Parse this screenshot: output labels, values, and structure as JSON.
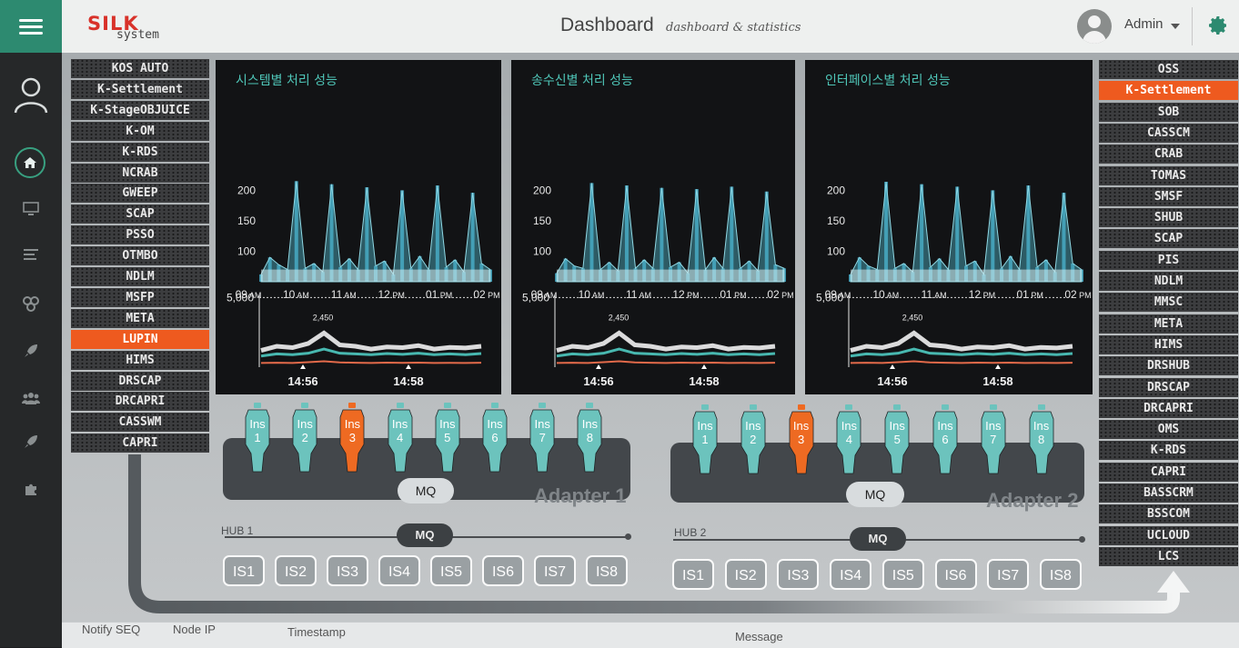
{
  "header": {
    "logo_main": "SILK",
    "logo_sub": "system",
    "title": "Dashboard",
    "subtitle": "dashboard & statistics",
    "user": "Admin",
    "brand_color": "#2d8a70"
  },
  "nav": {
    "items": [
      "user-icon",
      "home-icon",
      "monitor-icon",
      "list-icon",
      "settings-cluster-icon",
      "rocket-icon",
      "group-icon",
      "rocket-icon",
      "puzzle-icon"
    ],
    "active": "home-icon"
  },
  "left_systems": {
    "items": [
      "KOS AUTO",
      "K-Settlement",
      "K-StageOBJUICE",
      "K-OM",
      "K-RDS",
      "NCRAB",
      "GWEEP",
      "SCAP",
      "PSSO",
      "OTMBO",
      "NDLM",
      "MSFP",
      "META",
      "LUPIN",
      "HIMS",
      "DRSCAP",
      "DRCAPRI",
      "CASSWM",
      "CAPRI"
    ],
    "highlight": "LUPIN",
    "highlight_color": "#ee5a1f"
  },
  "right_systems": {
    "items": [
      "OSS",
      "K-Settlement",
      "SOB",
      "CASSCM",
      "CRAB",
      "TOMAS",
      "SMSF",
      "SHUB",
      "SCAP",
      "PIS",
      "NDLM",
      "MMSC",
      "META",
      "HIMS",
      "DRSHUB",
      "DRSCAP",
      "DRCAPRI",
      "OMS",
      "K-RDS",
      "CAPRI",
      "BASSCRM",
      "BSSCOM",
      "UCLOUD",
      "LCS"
    ],
    "highlight": "K-Settlement",
    "highlight_color": "#ee5a1f"
  },
  "panels": [
    {
      "title": "시스템별 처리 성능"
    },
    {
      "title": "송수신별 처리 성능"
    },
    {
      "title": "인터페이스별 처리 성능"
    }
  ],
  "chart_data": [
    {
      "type": "area",
      "title": "시스템별 처리 성능",
      "x_ticks": [
        "09 AM",
        "10 AM",
        "11 AM",
        "12 PM",
        "01 PM",
        "02 PM"
      ],
      "y_ticks": [
        100,
        150,
        200
      ],
      "ylim": [
        50,
        220
      ],
      "series": [
        {
          "values": [
            62,
            90,
            78,
            70,
            215,
            72,
            80,
            66,
            210,
            74,
            88,
            70,
            205,
            76,
            84,
            62,
            200,
            72,
            92,
            70,
            208,
            74,
            86,
            66,
            196,
            80,
            70
          ]
        }
      ]
    },
    {
      "type": "line",
      "x_ticks": [
        "14:56",
        "14:58"
      ],
      "y_ticks": [
        5000
      ],
      "reference_line": 5000,
      "annotation": "2,450",
      "ylim": [
        0,
        6000
      ],
      "series": [
        {
          "values": [
            1200,
            1500,
            1400,
            1700,
            2450,
            1600,
            1500,
            1300,
            1450,
            1400,
            1550,
            1300,
            1420,
            1380,
            1500
          ]
        },
        {
          "values": [
            800,
            950,
            900,
            1000,
            1300,
            1000,
            950,
            900,
            980,
            920,
            1000,
            900,
            950,
            900,
            980
          ]
        },
        {
          "values": [
            300,
            320,
            300,
            360,
            420,
            340,
            320,
            300,
            330,
            310,
            330,
            300,
            310,
            300,
            320
          ]
        }
      ]
    },
    {
      "type": "area",
      "title": "송수신별 처리 성능",
      "x_ticks": [
        "09 AM",
        "10 AM",
        "11 AM",
        "12 PM",
        "01 PM",
        "02 PM"
      ],
      "y_ticks": [
        100,
        150,
        200
      ],
      "ylim": [
        50,
        220
      ],
      "series": [
        {
          "values": [
            64,
            88,
            76,
            72,
            212,
            70,
            82,
            68,
            208,
            72,
            86,
            72,
            204,
            74,
            82,
            64,
            202,
            70,
            90,
            72,
            206,
            72,
            84,
            68,
            198,
            78,
            72
          ]
        }
      ]
    },
    {
      "type": "line",
      "x_ticks": [
        "14:56",
        "14:58"
      ],
      "y_ticks": [
        5000
      ],
      "reference_line": 5000,
      "annotation": "2,450",
      "ylim": [
        0,
        6000
      ],
      "series": [
        {
          "values": [
            1200,
            1500,
            1400,
            1700,
            2450,
            1600,
            1500,
            1300,
            1450,
            1400,
            1550,
            1300,
            1420,
            1380,
            1500
          ]
        },
        {
          "values": [
            800,
            950,
            900,
            1000,
            1300,
            1000,
            950,
            900,
            980,
            920,
            1000,
            900,
            950,
            900,
            980
          ]
        },
        {
          "values": [
            300,
            320,
            300,
            360,
            420,
            340,
            320,
            300,
            330,
            310,
            330,
            300,
            310,
            300,
            320
          ]
        }
      ]
    },
    {
      "type": "area",
      "title": "인터페이스별 처리 성능",
      "x_ticks": [
        "09 AM",
        "10 AM",
        "11 AM",
        "12 PM",
        "01 PM",
        "02 PM"
      ],
      "y_ticks": [
        100,
        150,
        200
      ],
      "ylim": [
        50,
        220
      ],
      "series": [
        {
          "values": [
            62,
            90,
            76,
            70,
            214,
            72,
            80,
            66,
            210,
            74,
            88,
            70,
            206,
            76,
            84,
            62,
            200,
            72,
            92,
            70,
            208,
            74,
            86,
            66,
            196,
            80,
            70
          ]
        }
      ]
    },
    {
      "type": "line",
      "x_ticks": [
        "14:56",
        "14:58"
      ],
      "y_ticks": [
        5000
      ],
      "reference_line": 5000,
      "annotation": "2,450",
      "ylim": [
        0,
        6000
      ],
      "series": [
        {
          "values": [
            1200,
            1500,
            1400,
            1700,
            2450,
            1600,
            1500,
            1300,
            1450,
            1400,
            1550,
            1300,
            1420,
            1380,
            1500
          ]
        },
        {
          "values": [
            800,
            950,
            900,
            1000,
            1300,
            1000,
            950,
            900,
            980,
            920,
            1000,
            900,
            950,
            900,
            980
          ]
        },
        {
          "values": [
            300,
            320,
            300,
            360,
            420,
            340,
            320,
            300,
            330,
            310,
            330,
            300,
            310,
            300,
            320
          ]
        }
      ]
    }
  ],
  "adapters": [
    {
      "name": "Adapter 1",
      "mq": "MQ",
      "hub": "HUB 1",
      "hub_mq": "MQ",
      "instances": [
        "1",
        "2",
        "3",
        "4",
        "5",
        "6",
        "7",
        "8"
      ],
      "instance_label": "Ins",
      "alert_instance": "3",
      "servers": [
        "IS1",
        "IS2",
        "IS3",
        "IS4",
        "IS5",
        "IS6",
        "IS7",
        "IS8"
      ]
    },
    {
      "name": "Adapter 2",
      "mq": "MQ",
      "hub": "HUB 2",
      "hub_mq": "MQ",
      "instances": [
        "1",
        "2",
        "3",
        "4",
        "5",
        "6",
        "7",
        "8"
      ],
      "instance_label": "Ins",
      "alert_instance": "3",
      "servers": [
        "IS1",
        "IS2",
        "IS3",
        "IS4",
        "IS5",
        "IS6",
        "IS7",
        "IS8"
      ]
    }
  ],
  "colors": {
    "instance_ok": "#6cc3bd",
    "instance_alert": "#ee6a22",
    "chart_primary": "#4fb3c8"
  },
  "footer": {
    "cols": [
      "Notify SEQ",
      "Node IP",
      "Timestamp",
      "Message"
    ]
  }
}
